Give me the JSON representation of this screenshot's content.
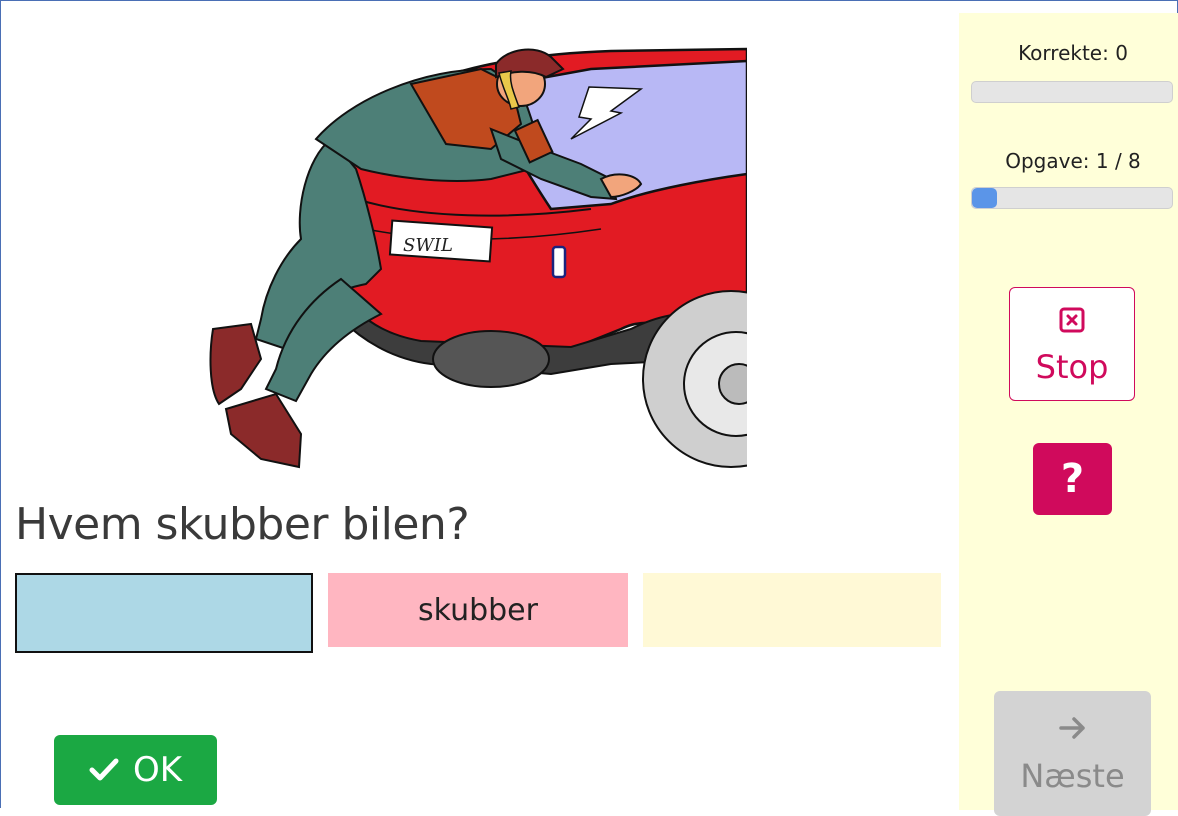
{
  "question": "Hvem skubber bilen?",
  "answer_slots": [
    {
      "text": "",
      "color": "#add8e6",
      "selected": true
    },
    {
      "text": "skubber",
      "color": "#ffb6c1",
      "selected": false
    },
    {
      "text": "",
      "color": "#fff9d6",
      "selected": false
    }
  ],
  "illustration": {
    "plate_text": "SWIL",
    "subject": "man pushing a red car"
  },
  "ok_button": {
    "label": "OK",
    "icon": "checkmark-icon"
  },
  "sidebar": {
    "correct_label": "Korrekte: 0",
    "correct_progress": 0,
    "task_label": "Opgave: 1 / 8",
    "task_progress": 0.125,
    "stop_button": {
      "label": "Stop",
      "icon": "close-square-icon"
    },
    "help_button": {
      "label": "?"
    },
    "next_button": {
      "label": "Næste",
      "icon": "arrow-right-icon",
      "enabled": false
    }
  },
  "colors": {
    "sidebar_bg": "#ffffd9",
    "ok_green": "#1ba843",
    "accent_pink": "#d00a5c",
    "progress_blue": "#5b95e8",
    "disabled_gray": "#d3d3d3"
  }
}
